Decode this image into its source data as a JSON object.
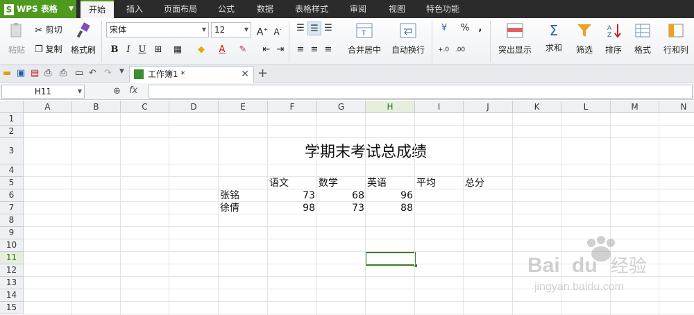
{
  "app": {
    "name": "WPS 表格"
  },
  "menu": {
    "tabs": [
      "开始",
      "插入",
      "页面布局",
      "公式",
      "数据",
      "表格样式",
      "审阅",
      "视图",
      "特色功能"
    ],
    "active": "开始"
  },
  "ribbon": {
    "paste": "粘贴",
    "cut": "剪切",
    "copy": "复制",
    "format_painter": "格式刷",
    "font_name": "宋体",
    "font_size": "12",
    "bold": "B",
    "italic": "I",
    "underline": "U",
    "merge_center": "合并居中",
    "wrap_text": "自动换行",
    "percent": "%",
    "comma": ",",
    "decimal_inc": "+.0 .00",
    "decimal_dec": "-.00 .0",
    "highlight": "突出显示",
    "sum": "求和",
    "filter": "筛选",
    "sort": "排序",
    "format": "格式",
    "row_col": "行和列"
  },
  "doc_tab": {
    "title": "工作簿1 *"
  },
  "formula_bar": {
    "cell_ref": "H11",
    "fx": "fx",
    "value": ""
  },
  "grid": {
    "columns": [
      "A",
      "B",
      "C",
      "D",
      "E",
      "F",
      "G",
      "H",
      "I",
      "J",
      "K",
      "L",
      "M",
      "N"
    ],
    "selected_column": "H",
    "rows": [
      "1",
      "2",
      "3",
      "4",
      "5",
      "6",
      "7",
      "8",
      "9",
      "10",
      "11",
      "12",
      "13",
      "14",
      "15"
    ],
    "selected_row": "11",
    "title": "学期末考试总成绩",
    "headers": [
      "语文",
      "数学",
      "英语",
      "平均",
      "总分"
    ],
    "students": [
      {
        "name": "张铭",
        "scores": [
          "73",
          "68",
          "96"
        ]
      },
      {
        "name": "徐倩",
        "scores": [
          "98",
          "73",
          "88"
        ]
      }
    ]
  },
  "colors": {
    "accent": "#4e9a1e",
    "selection": "#3f7d2a"
  }
}
